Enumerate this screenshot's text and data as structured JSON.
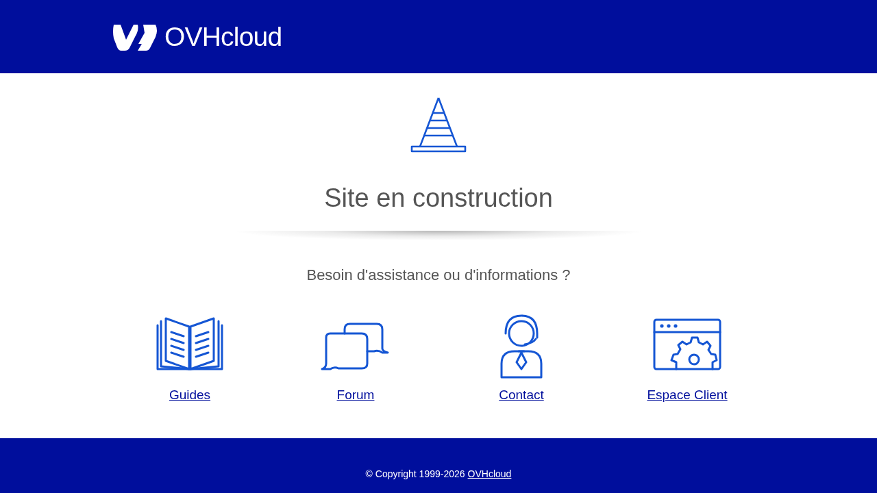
{
  "header": {
    "logo_text": "OVHcloud"
  },
  "main": {
    "title": "Site en construction",
    "subtitle": "Besoin d'assistance ou d'informations ?",
    "links": [
      {
        "kind": "guides",
        "label": "Guides"
      },
      {
        "kind": "forum",
        "label": "Forum"
      },
      {
        "kind": "contact",
        "label": "Contact"
      },
      {
        "kind": "account",
        "label": "Espace Client"
      }
    ]
  },
  "footer": {
    "copyright": "© Copyright 1999-2026",
    "link": "OVHcloud"
  }
}
